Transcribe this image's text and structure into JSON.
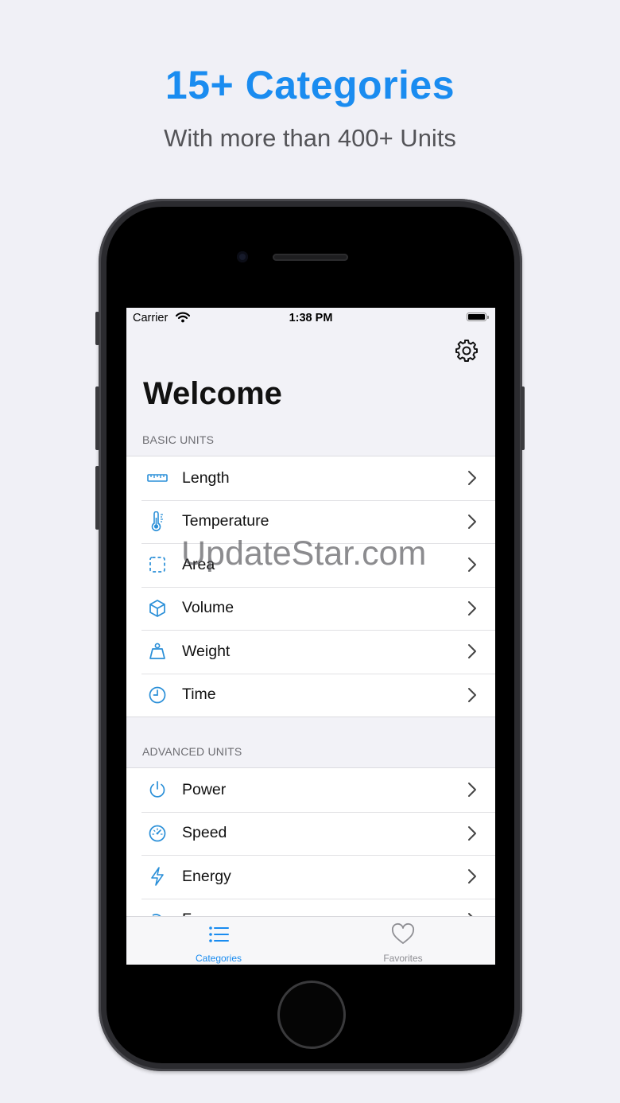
{
  "promo": {
    "headline": "15+ Categories",
    "subline": "With more than 400+ Units"
  },
  "status_bar": {
    "carrier": "Carrier",
    "time": "1:38 PM"
  },
  "nav": {
    "title": "Welcome",
    "settings_icon": "gear-icon"
  },
  "sections": [
    {
      "header": "BASIC UNITS",
      "items": [
        {
          "label": "Length",
          "icon": "ruler-icon"
        },
        {
          "label": "Temperature",
          "icon": "thermometer-icon"
        },
        {
          "label": "Area",
          "icon": "dashed-square-icon"
        },
        {
          "label": "Volume",
          "icon": "cube-icon"
        },
        {
          "label": "Weight",
          "icon": "scale-weight-icon"
        },
        {
          "label": "Time",
          "icon": "clock-icon"
        }
      ]
    },
    {
      "header": "ADVANCED UNITS",
      "items": [
        {
          "label": "Power",
          "icon": "power-icon"
        },
        {
          "label": "Speed",
          "icon": "speedometer-icon"
        },
        {
          "label": "Energy",
          "icon": "bolt-icon"
        },
        {
          "label": "F...",
          "icon": "partial-icon"
        }
      ]
    }
  ],
  "tab_bar": {
    "tabs": [
      {
        "label": "Categories",
        "icon": "list-icon",
        "selected": true
      },
      {
        "label": "Favorites",
        "icon": "heart-icon",
        "selected": false
      }
    ]
  },
  "watermark": "UpdateStar.com",
  "colors": {
    "accent": "#1a8cf0",
    "icon_blue": "#2a8fd8",
    "background": "#f2f2f7",
    "inactive_tab": "#8e8e93"
  }
}
